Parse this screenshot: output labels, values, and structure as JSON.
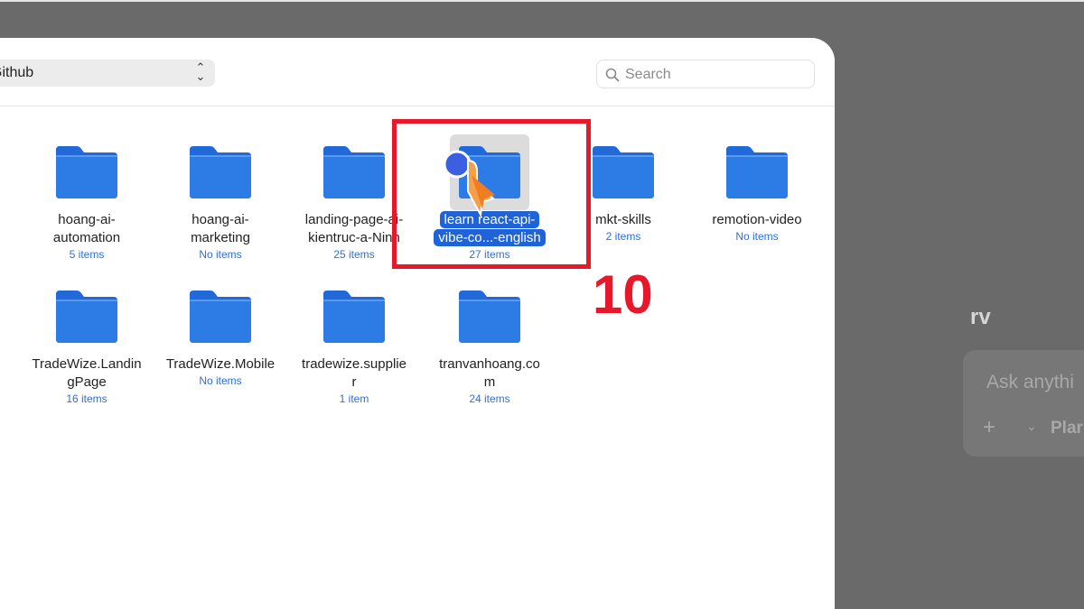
{
  "path_bar": {
    "label": "Github"
  },
  "search": {
    "placeholder": "Search"
  },
  "folders": [
    {
      "name": "hoang-ai-automation",
      "line1": "hoang-ai-",
      "line2": "automation",
      "count": "5 items"
    },
    {
      "name": "hoang-ai-marketing",
      "line1": "hoang-ai-",
      "line2": "marketing",
      "count": "No items"
    },
    {
      "name": "landing-page-ai-kientruc-a-Ninh",
      "line1": "landing-page-ai-",
      "line2": "kientruc-a-Ninh",
      "count": "25 items"
    },
    {
      "name": "learn-react-api-vibe-co...-english",
      "line1": "learn react-api-",
      "line2": "vibe-co...-english",
      "count": "27 items",
      "selected": true
    },
    {
      "name": "mkt-skills",
      "line1": "mkt-skills",
      "line2": "",
      "count": "2 items"
    },
    {
      "name": "remotion-video",
      "line1": "remotion-video",
      "line2": "",
      "count": "No items"
    },
    {
      "name": "TradeWize.LandingPage",
      "line1": "TradeWize.Landin",
      "line2": "gPage",
      "count": "16 items"
    },
    {
      "name": "TradeWize.Mobile",
      "line1": "TradeWize.Mobile",
      "line2": "",
      "count": "No items"
    },
    {
      "name": "tradewize.supplier",
      "line1": "tradewize.supplie",
      "line2": "r",
      "count": "1 item"
    },
    {
      "name": "tranvanhoang.com",
      "line1": "tranvanhoang.co",
      "line2": "m",
      "count": "24 items"
    }
  ],
  "annotation": {
    "step": "10",
    "color": "#e8182a"
  },
  "background_app": {
    "title": "rv",
    "input_placeholder": "Ask anythi",
    "plus": "+",
    "mode_label": "Plar"
  },
  "colors": {
    "folder_blue": "#2d7be5",
    "selection_blue": "#1f63d6"
  }
}
